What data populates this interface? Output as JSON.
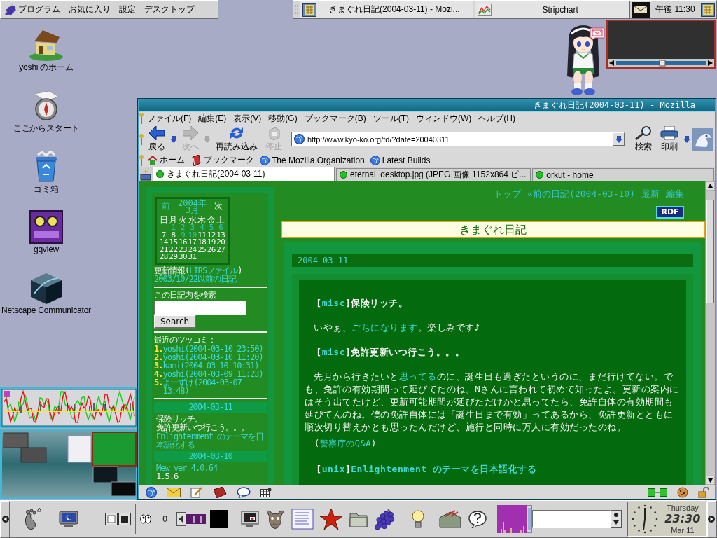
{
  "top_panel": {
    "menus": [
      {
        "label": "プログラム",
        "kind": "programs"
      },
      {
        "label": "お気に入り",
        "kind": "plain"
      },
      {
        "label": "設定",
        "kind": "plain"
      },
      {
        "label": "デスクトップ",
        "kind": "plain"
      }
    ],
    "tasks": [
      {
        "label": "きまぐれ日記(2004-03-11) - Mozi...",
        "kind": "browser"
      },
      {
        "label": "Stripchart",
        "kind": "chart"
      }
    ],
    "clock": "午後 11:30"
  },
  "desktop_icons": [
    {
      "label": "yoshi のホーム",
      "kind": "home"
    },
    {
      "label": "ここからスタート",
      "kind": "start"
    },
    {
      "label": "ゴミ箱",
      "kind": "trash"
    },
    {
      "label": "gqview",
      "kind": "gqview"
    },
    {
      "label": "Netscape Communicator",
      "kind": "netscape"
    }
  ],
  "mozilla": {
    "title": "きまぐれ日記(2004-03-11) - Mozilla",
    "menu": [
      "ファイル(F)",
      "編集(E)",
      "表示(V)",
      "移動(G)",
      "ブックマーク(B)",
      "ツール(T)",
      "ウィンドウ(W)",
      "ヘルプ(H)"
    ],
    "toolbar": {
      "buttons": [
        {
          "label": "戻る",
          "kind": "back",
          "disabled": false
        },
        {
          "label": "次へ",
          "kind": "forward",
          "disabled": true
        },
        {
          "label": "再読み込み",
          "kind": "reload",
          "disabled": false
        },
        {
          "label": "停止",
          "kind": "stop",
          "disabled": true
        }
      ],
      "url": "http://www.kyo-ko.org/td/?date=20040311",
      "tools": [
        {
          "label": "検索",
          "kind": "search"
        },
        {
          "label": "印刷",
          "kind": "print"
        }
      ]
    },
    "personal_toolbar": [
      {
        "label": "ホーム",
        "kind": "home"
      },
      {
        "label": "ブックマーク",
        "kind": "bookmarks"
      },
      {
        "label": "The Mozilla Organization",
        "kind": "site"
      },
      {
        "label": "Latest Builds",
        "kind": "site"
      }
    ],
    "tabs": [
      {
        "label": "きまぐれ日記(2004-03-11)",
        "selected": true
      },
      {
        "label": "eternal_desktop.jpg (JPEG 画像 1152x864 ピ...",
        "selected": false
      },
      {
        "label": "orkut - home",
        "selected": false
      }
    ],
    "page": {
      "sidebar": {
        "calendar": {
          "prev": "前",
          "year": "2004年",
          "month": "3月",
          "next": "次",
          "weekdays": [
            "日",
            "月",
            "火",
            "水",
            "木",
            "金",
            "土"
          ],
          "weeks": [
            [
              {
                "day": "1",
                "kind": "link"
              },
              {
                "day": "2",
                "kind": "link"
              },
              {
                "day": "3",
                "kind": "link"
              },
              {
                "day": "4",
                "kind": "link"
              },
              {
                "day": "5",
                "kind": "link"
              },
              {
                "day": "6",
                "kind": "link"
              }
            ],
            [
              {
                "day": "7",
                "kind": "text"
              },
              {
                "day": "8",
                "kind": "text"
              },
              {
                "day": "9",
                "kind": "link"
              },
              {
                "day": "10",
                "kind": "link"
              },
              {
                "day": "11",
                "kind": "text"
              },
              {
                "day": "12",
                "kind": "text"
              },
              {
                "day": "13",
                "kind": "text"
              }
            ],
            [
              {
                "day": "14",
                "kind": "text"
              },
              {
                "day": "15",
                "kind": "text"
              },
              {
                "day": "16",
                "kind": "text"
              },
              {
                "day": "17",
                "kind": "text"
              },
              {
                "day": "18",
                "kind": "text"
              },
              {
                "day": "19",
                "kind": "text"
              },
              {
                "day": "20",
                "kind": "text"
              }
            ],
            [
              {
                "day": "21",
                "kind": "text"
              },
              {
                "day": "22",
                "kind": "text"
              },
              {
                "day": "23",
                "kind": "text"
              },
              {
                "day": "24",
                "kind": "text"
              },
              {
                "day": "25",
                "kind": "text"
              },
              {
                "day": "26",
                "kind": "text"
              },
              {
                "day": "27",
                "kind": "text"
              }
            ],
            [
              {
                "day": "28",
                "kind": "text"
              },
              {
                "day": "29",
                "kind": "text"
              },
              {
                "day": "30",
                "kind": "text"
              },
              {
                "day": "31",
                "kind": "text"
              }
            ]
          ]
        },
        "update_info": [
          {
            "text": "更新情報(",
            "kind": "text"
          },
          {
            "text": "LIRSファイル",
            "kind": "link"
          },
          {
            "text": ")",
            "kind": "text"
          }
        ],
        "archive": "2003/10/22以前の日記",
        "search": {
          "label": "この日記内を検索",
          "button": "Search"
        },
        "comments": {
          "title": "最近のツッコミ：",
          "items": [
            {
              "number": "1.",
              "text": "yoshi(2004-03-10 23:50)"
            },
            {
              "number": "2.",
              "text": "yoshi(2004-03-10 11:20)"
            },
            {
              "number": "3.",
              "text": "kami(2004-03-10 10:31)"
            },
            {
              "number": "4.",
              "text": "yoshi(2004-03-09 11:23)"
            },
            {
              "number": "5.",
              "text": "よーずけ(2004-03-07 13:48)"
            }
          ]
        },
        "recent": [
          {
            "date": "2004-03-11",
            "items": [
              {
                "text": "保険リッチ。",
                "kind": "text"
              },
              {
                "text": "免許更新いつ行こう。。。",
                "kind": "text"
              },
              {
                "text": "Enlightenment のテーマを日本語化する",
                "kind": "link"
              }
            ]
          },
          {
            "date": "2004-03-10",
            "items": [
              {
                "text": "Mew ver 4.0.64",
                "kind": "link"
              },
              {
                "text": "1.5.6",
                "kind": "text"
              }
            ]
          }
        ]
      },
      "main": {
        "nav": [
          "トップ",
          "«前の日記(2004-03-10)",
          "最新",
          "編集"
        ],
        "rdf": "RDF",
        "title": "きまぐれ日記",
        "date": "2004-03-11",
        "sections": [
          {
            "heading": [
              {
                "text": "_",
                "kind": "anchor"
              },
              {
                "text": "[",
                "kind": "text"
              },
              {
                "text": "misc",
                "kind": "link"
              },
              {
                "text": "]保険リッチ。",
                "kind": "text"
              }
            ],
            "paragraphs": [
              {
                "kind": "body",
                "segments": [
                  {
                    "text": "いやぁ、",
                    "kind": "text"
                  },
                  {
                    "text": "ごちになります",
                    "kind": "link"
                  },
                  {
                    "text": "。楽しみです♪",
                    "kind": "text"
                  }
                ]
              }
            ]
          },
          {
            "heading": [
              {
                "text": "_",
                "kind": "anchor"
              },
              {
                "text": "[",
                "kind": "text"
              },
              {
                "text": "misc",
                "kind": "link"
              },
              {
                "text": "]免許更新いつ行こう。。。",
                "kind": "text"
              }
            ],
            "paragraphs": [
              {
                "kind": "body",
                "segments": [
                  {
                    "text": "先月から行きたいと",
                    "kind": "text"
                  },
                  {
                    "text": "思ってる",
                    "kind": "link"
                  },
                  {
                    "text": "のに、誕生日も過ぎたというのに、まだ行けてない。でも、免許の有効期間って延びてたのね。Nさんに言われて初めて知ったよ。更新の案内にはそう出てたけど、更新可能期間が延びただけかと思ってたら、免許自体の有効期間も延びてんのね。僕の免許自体には「誕生日まで有効」ってあるから、免許更新とともに順次切り替えかとも思ったんだけど、施行と同時に万人に有効だったのね。",
                    "kind": "text"
                  }
                ]
              },
              {
                "kind": "note",
                "segments": [
                  {
                    "text": "(",
                    "kind": "text"
                  },
                  {
                    "text": "警察庁のQ&A",
                    "kind": "link"
                  },
                  {
                    "text": ")",
                    "kind": "text"
                  }
                ]
              }
            ]
          },
          {
            "heading": [
              {
                "text": "_",
                "kind": "anchor"
              },
              {
                "text": "[",
                "kind": "text"
              },
              {
                "text": "unix",
                "kind": "link"
              },
              {
                "text": "]",
                "kind": "text"
              },
              {
                "text": "Enlightenment のテーマを日本語化する",
                "kind": "link"
              }
            ]
          }
        ]
      }
    }
  },
  "bottom_panel": {
    "counter": "0",
    "clock": {
      "weekday": "Thursday",
      "time": "23:30",
      "date": "Mar 11"
    }
  }
}
